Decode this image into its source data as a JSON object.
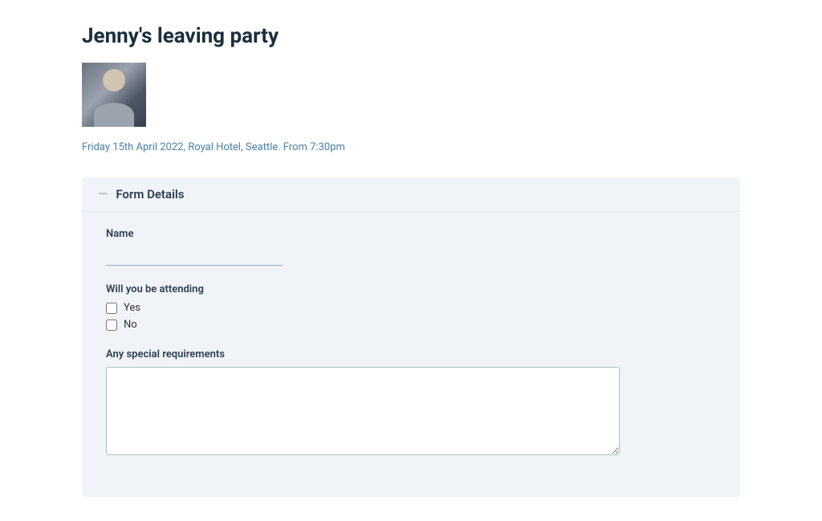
{
  "page": {
    "title": "Jenny's leaving party",
    "event_date": "Friday 15th April 2022, Royal Hotel, Seattle. From 7:30pm",
    "image_alt": "Jenny's photo"
  },
  "form_section": {
    "title": "Form Details",
    "collapse_icon": "—"
  },
  "fields": {
    "name_label": "Name",
    "name_placeholder": "",
    "attending_label": "Will you be attending",
    "attending_options": [
      {
        "id": "yes",
        "label": "Yes"
      },
      {
        "id": "no",
        "label": "No"
      }
    ],
    "requirements_label": "Any special requirements",
    "requirements_placeholder": ""
  }
}
